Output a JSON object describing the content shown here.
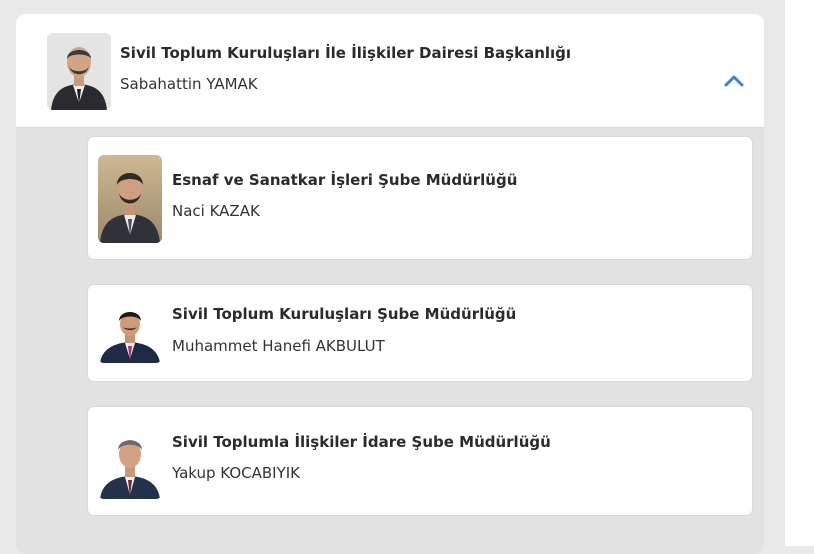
{
  "department": {
    "title": "Sivil Toplum Kuruluşları İle İlişkiler Dairesi Başkanlığı",
    "head_name": "Sabahattin YAMAK",
    "toggle_icon": "chevron-up-icon",
    "accent_color": "#3b82d6"
  },
  "branches": [
    {
      "title": "Esnaf ve Sanatkar İşleri Şube Müdürlüğü",
      "manager": "Naci KAZAK"
    },
    {
      "title": "Sivil Toplum Kuruluşları Şube Müdürlüğü",
      "manager": "Muhammet Hanefi AKBULUT"
    },
    {
      "title": "Sivil Toplumla İlişkiler İdare Şube Müdürlüğü",
      "manager": "Yakup KOCABIYIK"
    }
  ]
}
